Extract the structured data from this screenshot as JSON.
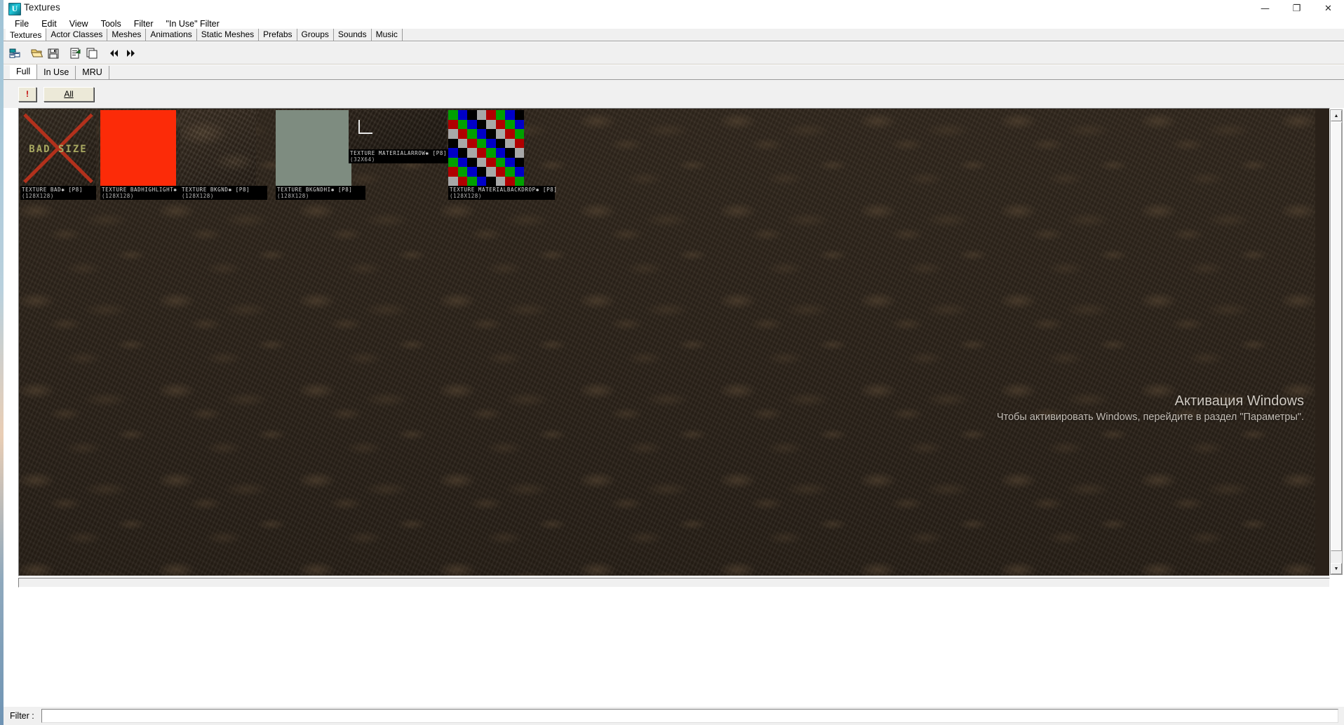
{
  "window": {
    "title": "Textures",
    "icon": "unreal-logo-icon",
    "controls": {
      "minimize": "—",
      "maximize": "❐",
      "close": "✕"
    }
  },
  "menubar": {
    "items": [
      {
        "label": "File",
        "name": "menu-file"
      },
      {
        "label": "Edit",
        "name": "menu-edit"
      },
      {
        "label": "View",
        "name": "menu-view"
      },
      {
        "label": "Tools",
        "name": "menu-tools"
      },
      {
        "label": "Filter",
        "name": "menu-filter"
      },
      {
        "label": "\"In Use\" Filter",
        "name": "menu-in-use-filter"
      }
    ]
  },
  "tabs": {
    "active": "Textures",
    "items": [
      {
        "label": "Textures"
      },
      {
        "label": "Actor Classes"
      },
      {
        "label": "Meshes"
      },
      {
        "label": "Animations"
      },
      {
        "label": "Static Meshes"
      },
      {
        "label": "Prefabs"
      },
      {
        "label": "Groups"
      },
      {
        "label": "Sounds"
      },
      {
        "label": "Music"
      }
    ]
  },
  "toolbar": {
    "buttons": [
      {
        "name": "new-package-icon",
        "tooltip": "New"
      },
      {
        "name": "open-folder-icon",
        "tooltip": "Open"
      },
      {
        "name": "save-disk-icon",
        "tooltip": "Save"
      },
      {
        "name": "properties-icon",
        "tooltip": "Properties"
      },
      {
        "name": "duplicate-copy-icon",
        "tooltip": "Duplicate"
      },
      {
        "name": "prev-arrows-icon",
        "tooltip": "Previous"
      },
      {
        "name": "next-arrows-icon",
        "tooltip": "Next"
      }
    ]
  },
  "subtabs": {
    "active": "Full",
    "items": [
      {
        "label": "Full"
      },
      {
        "label": "In Use"
      },
      {
        "label": "MRU"
      }
    ]
  },
  "filter_buttons": {
    "bang": "!",
    "all": "All"
  },
  "browser": {
    "textures": [
      {
        "name": "TEXTURE BAD✱ [P8]",
        "dimensions": "(128X128)",
        "swatch": "bad-size",
        "overlay_text": "BAD SIZE"
      },
      {
        "name": "TEXTURE BADHIGHLIGHT✱ [P8]",
        "dimensions": "(128X128)",
        "swatch": "solid-red",
        "color": "#fc2b08"
      },
      {
        "name": "TEXTURE BKGND✱ [P8]",
        "dimensions": "(128X128)",
        "swatch": "dark-noise"
      },
      {
        "name": "TEXTURE BKGNDHI✱ [P8]",
        "dimensions": "(128X128)",
        "swatch": "solid-green-gray",
        "color": "#7e8c80"
      },
      {
        "name": "TEXTURE MATERIALARROW✱ [P8]",
        "dimensions": "(32X64)",
        "swatch": "arrow-corner"
      },
      {
        "name": "TEXTURE MATERIALBACKDROP✱ [P8]",
        "dimensions": "(128X128)",
        "swatch": "checkerboard",
        "palette": [
          "#00a000",
          "#0000c8",
          "#000000",
          "#a8a8a8",
          "#b00000"
        ]
      }
    ]
  },
  "scrollbar": {
    "up_arrow": "▲",
    "down_arrow": "▼"
  },
  "footer": {
    "filter_label": "Filter :",
    "filter_value": "",
    "filter_placeholder": ""
  },
  "watermark": {
    "title": "Активация Windows",
    "subtitle": "Чтобы активировать Windows, перейдите в раздел \"Параметры\"."
  }
}
